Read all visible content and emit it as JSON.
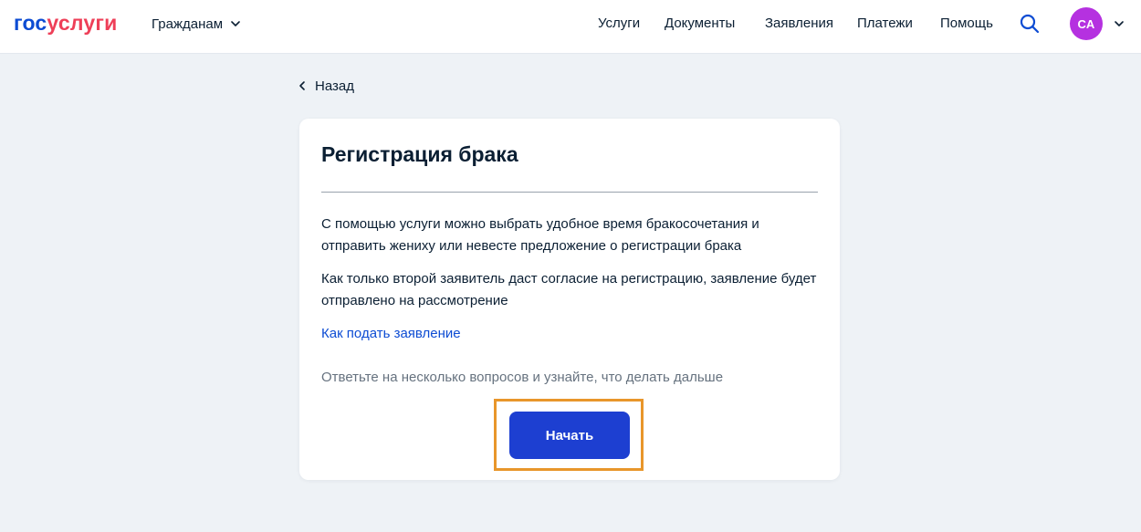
{
  "header": {
    "logo": {
      "part_a": "гос",
      "part_b": "услуги"
    },
    "audience_label": "Гражданам",
    "nav": [
      {
        "label": "Услуги"
      },
      {
        "label": "Документы"
      },
      {
        "label": "Заявления"
      },
      {
        "label": "Платежи"
      },
      {
        "label": "Помощь"
      }
    ],
    "search_icon": "search-icon",
    "avatar_initials": "СА",
    "colors": {
      "logo_blue": "#0d4cd3",
      "logo_red": "#ee3f58",
      "avatar": "#b531e0"
    }
  },
  "back_label": "Назад",
  "card": {
    "title": "Регистрация брака",
    "paragraph1": "С помощью услуги можно выбрать удобное время бракосочетания и отправить жениху или невесте предложение о регистрации брака",
    "paragraph2": "Как только второй заявитель даст согласие на регистрацию, заявление будет отправлено на рассмотрение",
    "how_to_link": "Как подать заявление",
    "hint": "Ответьте на несколько вопросов и узнайте, что делать дальше",
    "start_button": "Начать"
  },
  "colors": {
    "primary_button": "#1d3fd1",
    "link": "#0d4cd3",
    "highlight_border": "#e8962b",
    "page_background": "#eef2f6"
  }
}
